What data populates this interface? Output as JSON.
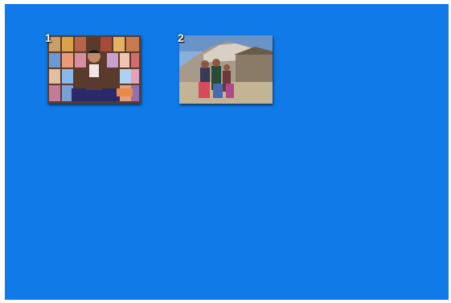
{
  "canvas": {
    "background_color": "#0f7ae8"
  },
  "photos": [
    {
      "number": "1",
      "subject": "boy-seated-before-thangka-paintings"
    },
    {
      "number": "2",
      "subject": "children-in-front-of-hillside-monastery"
    }
  ]
}
